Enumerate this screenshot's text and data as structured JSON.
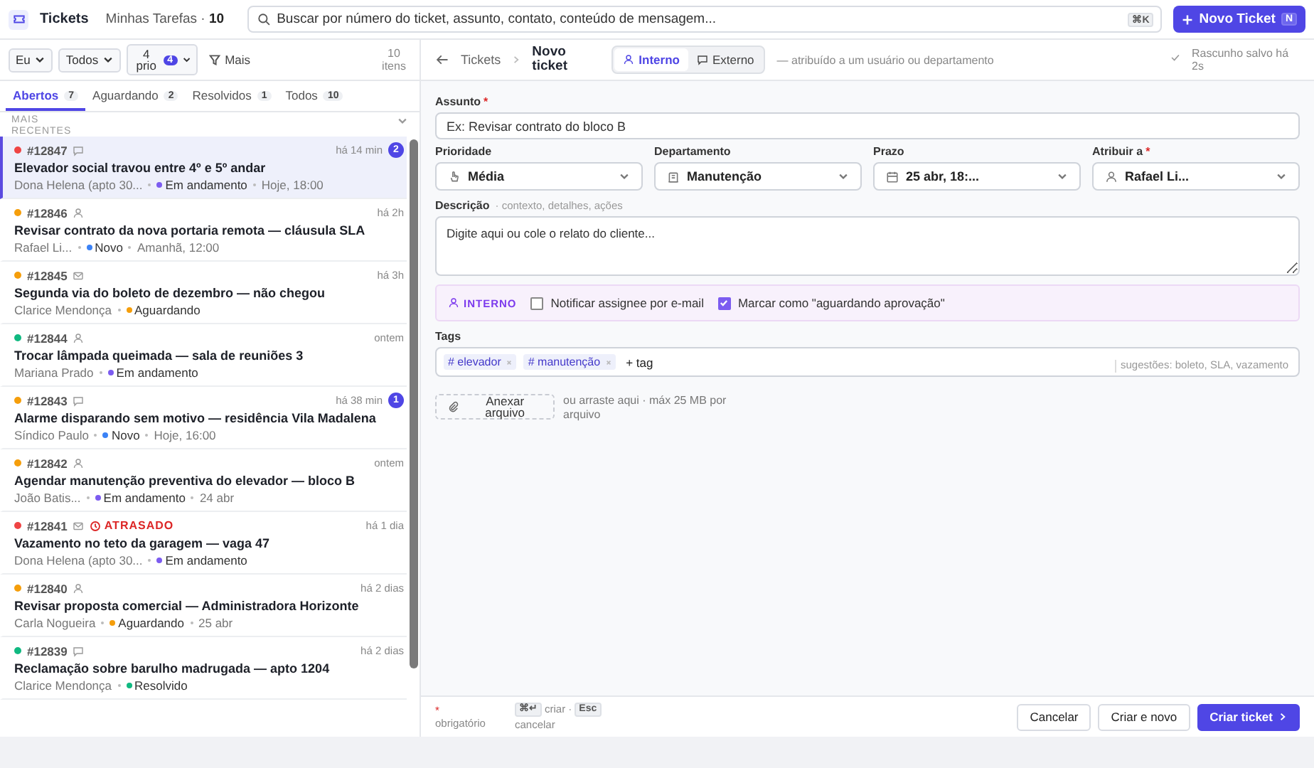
{
  "app": {
    "title": "Tickets",
    "subtitle": "Minhas Tarefas · ",
    "count": "10"
  },
  "search": {
    "placeholder": "Buscar por número do ticket, assunto, contato, conteúdo de mensagem...",
    "shortcut": "⌘K"
  },
  "new_button": {
    "label": "Novo Ticket",
    "shortcut": "N"
  },
  "filters": [
    {
      "label": "Eu"
    },
    {
      "label": "Todos"
    },
    {
      "label": "4 prio",
      "badge": "4"
    }
  ],
  "more_filter": "Mais",
  "items_count": "10 itens",
  "tabs": [
    {
      "label": "Abertos",
      "count": "7",
      "selected": true
    },
    {
      "label": "Aguardando",
      "count": "2",
      "selected": false
    },
    {
      "label": "Resolvidos",
      "count": "1",
      "selected": false
    },
    {
      "label": "Todos",
      "count": "10",
      "selected": false
    }
  ],
  "sort": "MAIS RECENTES",
  "tickets": [
    {
      "id": "#12847",
      "color": "#ef4444",
      "kind": "chat",
      "time": "há 14 min",
      "unread": "2",
      "title": "Elevador social travou entre 4º e 5º andar",
      "contact": "Dona Helena (apto 30...",
      "status": {
        "label": "Em andamento",
        "color": "#7c5cf0"
      },
      "due": "Hoje, 18:00",
      "selected": true
    },
    {
      "id": "#12846",
      "color": "#f59e0b",
      "kind": "person",
      "time": "há 2h",
      "title": "Revisar contrato da nova portaria remota — cláusula SLA",
      "contact": "Rafael Li...",
      "status": {
        "label": "Novo",
        "color": "#3b82f6"
      },
      "due": "Amanhã, 12:00",
      "selected": false
    },
    {
      "id": "#12845",
      "color": "#f59e0b",
      "kind": "mail",
      "time": "há 3h",
      "title": "Segunda via do boleto de dezembro — não chegou",
      "contact": "Clarice Mendonça",
      "status": {
        "label": "Aguardando",
        "color": "#f59e0b"
      },
      "selected": false
    },
    {
      "id": "#12844",
      "color": "#10b981",
      "kind": "person",
      "time": "ontem",
      "title": "Trocar lâmpada queimada — sala de reuniões 3",
      "contact": "Mariana Prado",
      "status": {
        "label": "Em andamento",
        "color": "#7c5cf0"
      },
      "selected": false
    },
    {
      "id": "#12843",
      "color": "#f59e0b",
      "kind": "chat",
      "time": "há 38 min",
      "unread": "1",
      "title": "Alarme disparando sem motivo — residência Vila Madalena",
      "contact": "Síndico Paulo",
      "status": {
        "label": "Novo",
        "color": "#3b82f6"
      },
      "due": "Hoje, 16:00",
      "selected": false
    },
    {
      "id": "#12842",
      "color": "#f59e0b",
      "kind": "person",
      "time": "ontem",
      "title": "Agendar manutenção preventiva do elevador — bloco B",
      "contact": "João Batis...",
      "status": {
        "label": "Em andamento",
        "color": "#7c5cf0"
      },
      "due": "24 abr",
      "selected": false
    },
    {
      "id": "#12841",
      "color": "#ef4444",
      "kind": "mail",
      "overdue": "ATRASADO",
      "time": "há 1 dia",
      "title": "Vazamento no teto da garagem — vaga 47",
      "contact": "Dona Helena (apto 30...",
      "status": {
        "label": "Em andamento",
        "color": "#7c5cf0"
      },
      "selected": false
    },
    {
      "id": "#12840",
      "color": "#f59e0b",
      "kind": "person",
      "time": "há 2 dias",
      "title": "Revisar proposta comercial — Administradora Horizonte",
      "contact": "Carla Nogueira",
      "status": {
        "label": "Aguardando",
        "color": "#f59e0b"
      },
      "due": "25 abr",
      "selected": false
    },
    {
      "id": "#12839",
      "color": "#10b981",
      "kind": "chat",
      "time": "há 2 dias",
      "title": "Reclamação sobre barulho madrugada — apto 1204",
      "contact": "Clarice Mendonça",
      "status": {
        "label": "Resolvido",
        "color": "#10b981"
      },
      "selected": false
    }
  ],
  "breadcrumb": {
    "parent": "Tickets",
    "current": "Novo ticket"
  },
  "modes": [
    {
      "label": "Interno",
      "selected": true
    },
    {
      "label": "Externo",
      "selected": false
    }
  ],
  "mode_hint": "— atribuído a um usuário ou departamento",
  "draft_status": "Rascunho salvo há 2s",
  "subject": {
    "label": "Assunto",
    "required": true,
    "placeholder": "Ex: Revisar contrato do bloco B"
  },
  "selects": [
    {
      "label": "Prioridade",
      "value": "Média",
      "required": false
    },
    {
      "label": "Departamento",
      "value": "Manutenção",
      "required": false
    },
    {
      "label": "Prazo",
      "value": "25 abr, 18:...",
      "required": false
    },
    {
      "label": "Atribuir a",
      "value": "Rafael Li...",
      "required": true
    }
  ],
  "description": {
    "label": "Descrição",
    "hint": "· contexto, detalhes, ações",
    "placeholder": "Digite aqui ou cole o relato do cliente..."
  },
  "internal_bar": {
    "label": "INTERNO",
    "options": [
      {
        "label": "Notificar assignee por e-mail",
        "checked": false
      },
      {
        "label": "Marcar como \"aguardando aprovação\"",
        "checked": true
      }
    ]
  },
  "tags": {
    "label": "Tags",
    "items": [
      "# elevador",
      "# manutenção"
    ],
    "placeholder": "+ tag",
    "suggestions": "sugestões: boleto, SLA, vazamento"
  },
  "attach": {
    "label": "Anexar arquivo",
    "hint": "ou arraste aqui · máx 25 MB por arquivo"
  },
  "footer": {
    "required_mark": "*",
    "required_note": "obrigatório",
    "create_key": "⌘↵",
    "create_hint": "criar ·",
    "cancel_key": "Esc",
    "cancel_hint": "cancelar",
    "buttons": [
      {
        "label": "Cancelar",
        "kind": "secondary"
      },
      {
        "label": "Criar e novo",
        "kind": "secondary"
      },
      {
        "label": "Criar ticket",
        "kind": "primary"
      }
    ]
  }
}
